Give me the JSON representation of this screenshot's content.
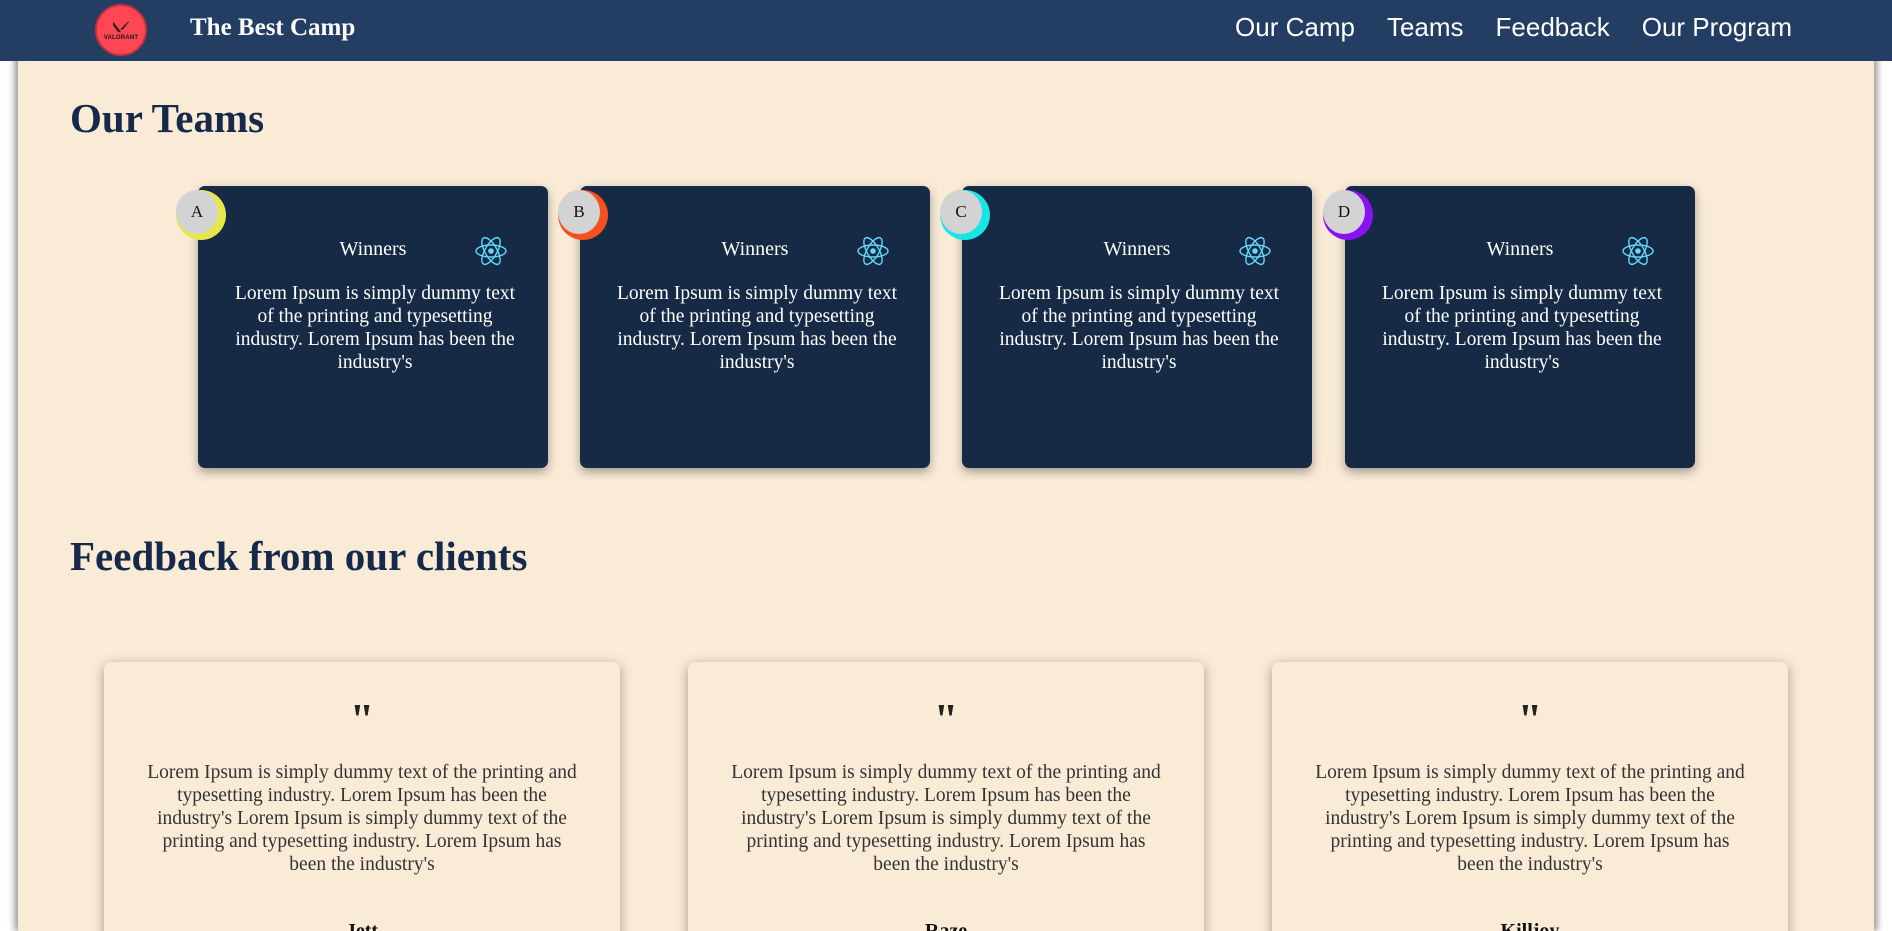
{
  "navbar": {
    "logo_text": "VALORANT",
    "brand": "The Best Camp",
    "links": [
      "Our Camp",
      "Teams",
      "Feedback",
      "Our Program"
    ]
  },
  "teams_section": {
    "title": "Our Teams",
    "cards": [
      {
        "badge": "A",
        "badge_color": "#e6e84a",
        "title": "Winners",
        "text": "Lorem Ipsum is simply dummy text of the printing and typesetting industry. Lorem Ipsum has been the industry's"
      },
      {
        "badge": "B",
        "badge_color": "#f4511e",
        "title": "Winners",
        "text": "Lorem Ipsum is simply dummy text of the printing and typesetting industry. Lorem Ipsum has been the industry's"
      },
      {
        "badge": "C",
        "badge_color": "#19e5e5",
        "title": "Winners",
        "text": "Lorem Ipsum is simply dummy text of the printing and typesetting industry. Lorem Ipsum has been the industry's"
      },
      {
        "badge": "D",
        "badge_color": "#8b12f0",
        "title": "Winners",
        "text": "Lorem Ipsum is simply dummy text of the printing and typesetting industry. Lorem Ipsum has been the industry's"
      }
    ],
    "icon": "react-icon"
  },
  "feedback_section": {
    "title": "Feedback from our clients",
    "cards": [
      {
        "quote": "\"",
        "text": "Lorem Ipsum is simply dummy text of the printing and typesetting industry. Lorem Ipsum has been the industry's Lorem Ipsum is simply dummy text of the printing and typesetting industry. Lorem Ipsum has been the industry's",
        "name": "Jett"
      },
      {
        "quote": "\"",
        "text": "Lorem Ipsum is simply dummy text of the printing and typesetting industry. Lorem Ipsum has been the industry's Lorem Ipsum is simply dummy text of the printing and typesetting industry. Lorem Ipsum has been the industry's",
        "name": "Raze"
      },
      {
        "quote": "\"",
        "text": "Lorem Ipsum is simply dummy text of the printing and typesetting industry. Lorem Ipsum has been the industry's Lorem Ipsum is simply dummy text of the printing and typesetting industry. Lorem Ipsum has been the industry's",
        "name": "Killjoy"
      }
    ]
  },
  "colors": {
    "navbar": "#233d63",
    "page_background": "#faebd7",
    "team_card": "#162a46",
    "heading": "#16294a",
    "logo": "#ff4655",
    "react_icon": "#61dafb"
  }
}
